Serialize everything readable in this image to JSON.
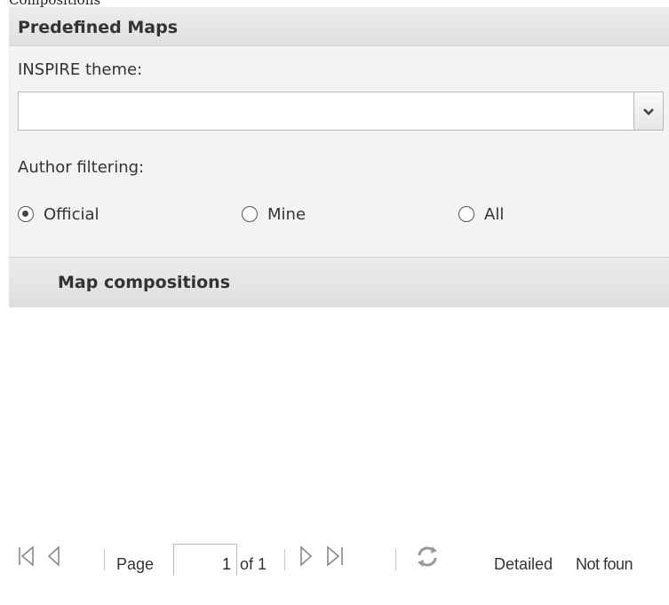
{
  "top_label": "Compositions",
  "panel": {
    "title": "Predefined Maps",
    "inspire_label": "INSPIRE theme:",
    "inspire_value": "",
    "author_label": "Author filtering:",
    "author_options": [
      "Official",
      "Mine",
      "All"
    ],
    "author_selected": "Official",
    "compositions_title": "Map compositions"
  },
  "pager": {
    "page_label": "Page",
    "page_value": "1",
    "of_label": "of 1",
    "detailed_label": "Detailed",
    "status": "Not foun"
  },
  "icons": {
    "first": "first-page-icon",
    "prev": "prev-page-icon",
    "next": "next-page-icon",
    "last": "last-page-icon",
    "refresh": "refresh-icon",
    "dropdown": "chevron-down-icon"
  }
}
